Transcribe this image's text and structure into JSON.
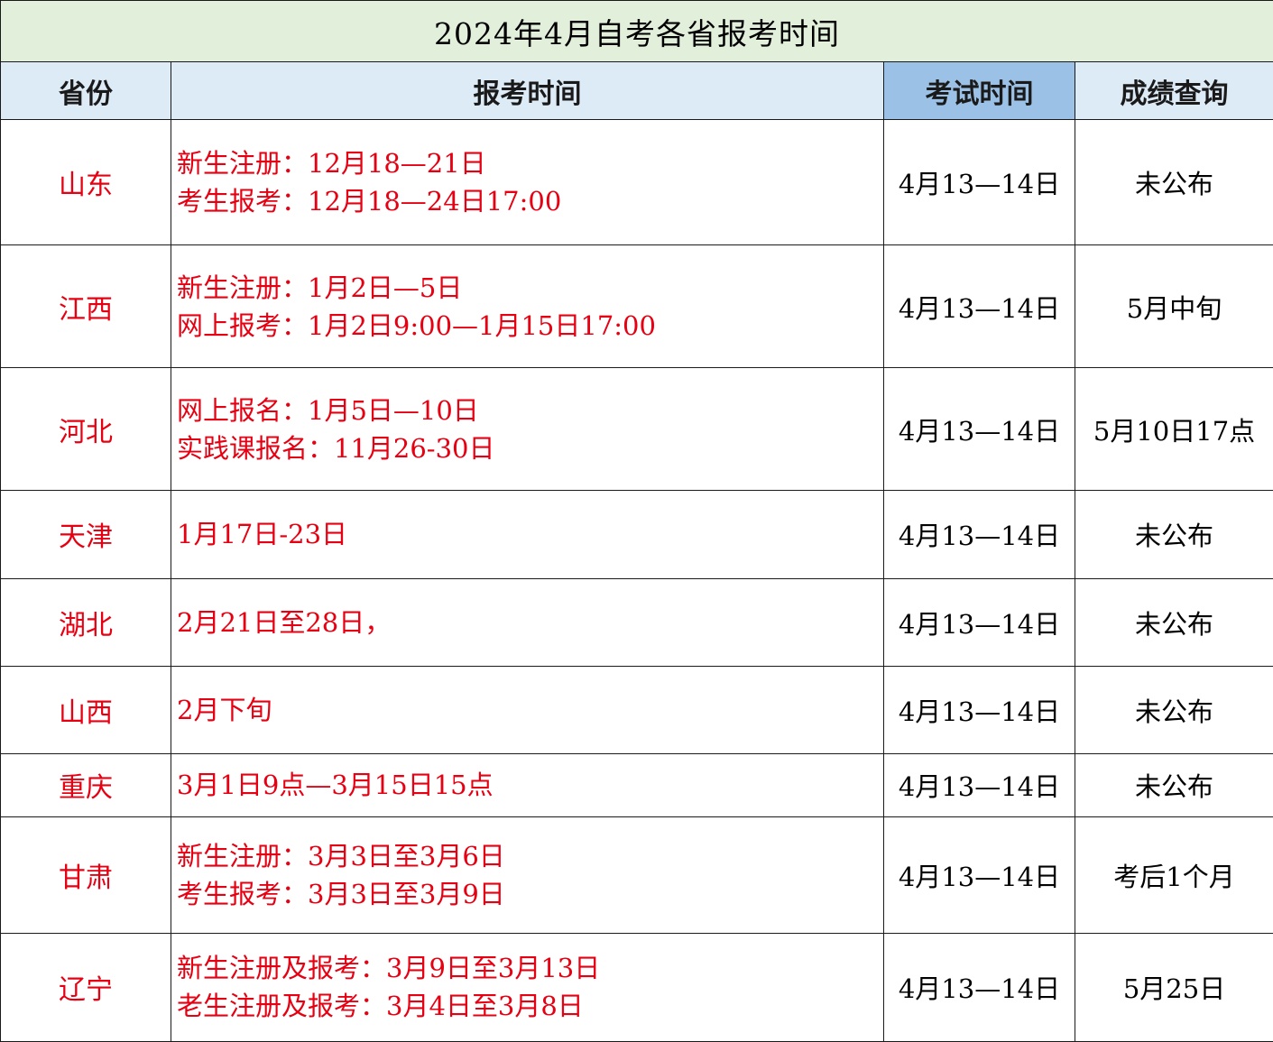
{
  "title": "2024年4月自考各省报考时间",
  "colors": {
    "title_bg": "#e2efda",
    "header_bg": "#ddebf7",
    "header_exam_bg": "#9bc2e6",
    "accent_red": "#e60012"
  },
  "headers": {
    "province": "省份",
    "registration": "报考时间",
    "exam": "考试时间",
    "score": "成绩查询"
  },
  "rows": [
    {
      "province": "山东",
      "reg": [
        "新生注册：12月18—21日",
        "考生报考：12月18—24日17:00"
      ],
      "exam": "4月13—14日",
      "score": "未公布"
    },
    {
      "province": "江西",
      "reg": [
        "新生注册：1月2日—5日",
        "网上报考：1月2日9:00—1月15日17:00"
      ],
      "exam": "4月13—14日",
      "score": "5月中旬"
    },
    {
      "province": "河北",
      "reg": [
        "网上报名：1月5日—10日",
        "实践课报名：11月26-30日"
      ],
      "exam": "4月13—14日",
      "score": "5月10日17点"
    },
    {
      "province": "天津",
      "reg": [
        "1月17日-23日"
      ],
      "exam": "4月13—14日",
      "score": "未公布"
    },
    {
      "province": "湖北",
      "reg": [
        "2月21日至28日，"
      ],
      "exam": "4月13—14日",
      "score": "未公布"
    },
    {
      "province": "山西",
      "reg": [
        "2月下旬"
      ],
      "exam": "4月13—14日",
      "score": "未公布"
    },
    {
      "province": "重庆",
      "reg": [
        "3月1日9点—3月15日15点"
      ],
      "exam": "4月13—14日",
      "score": "未公布"
    },
    {
      "province": "甘肃",
      "reg": [
        "新生注册：3月3日至3月6日",
        "考生报考：3月3日至3月9日"
      ],
      "exam": "4月13—14日",
      "score": "考后1个月"
    },
    {
      "province": "辽宁",
      "reg": [
        "新生注册及报考：3月9日至3月13日",
        "老生注册及报考：3月4日至3月8日"
      ],
      "exam": "4月13—14日",
      "score": "5月25日"
    }
  ]
}
